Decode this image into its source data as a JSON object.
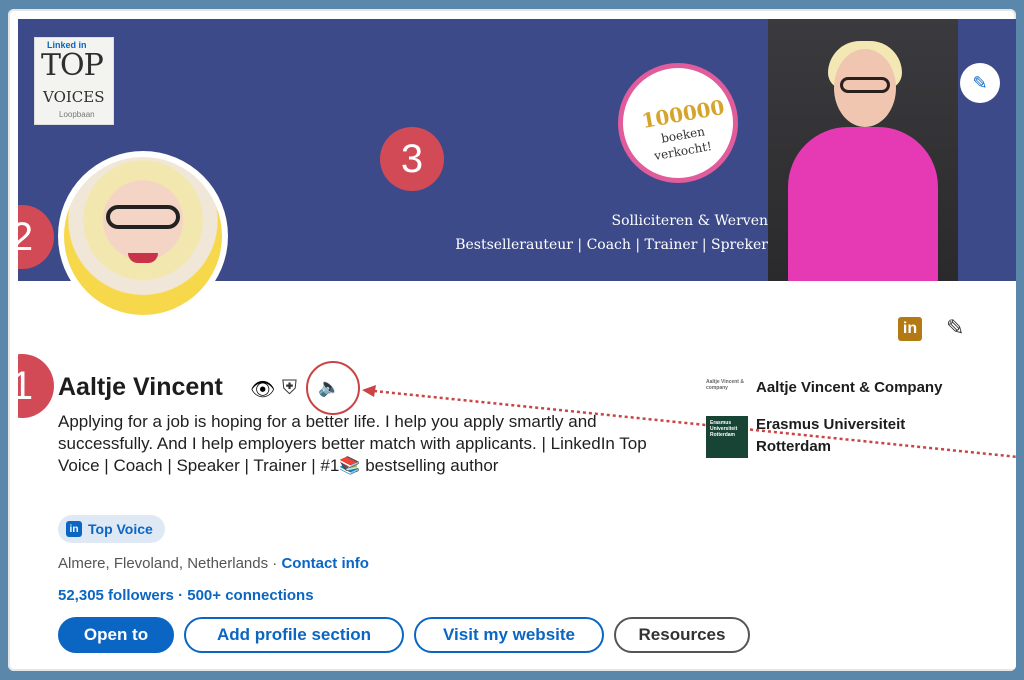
{
  "banner": {
    "badge_linkedin": "Linked in",
    "badge_top": "TOP",
    "badge_voices": "VOICES",
    "badge_sub": "Loopbaan",
    "seal_number": "100000",
    "seal_line1": "boeken",
    "seal_line2": "verkocht!",
    "tagline1": "Solliciteren & Werven",
    "tagline2": "Bestsellerauteur | Coach | Trainer | Spreker"
  },
  "annotations": {
    "n1": "1",
    "n2": "2",
    "n3": "3"
  },
  "profile": {
    "name": "Aaltje Vincent",
    "headline": "Applying for a job is hoping for a better life. I help you apply smartly and successfully. And I help employers better match with applicants. | LinkedIn Top Voice | Coach | Speaker | Trainer | #1📚 bestselling author",
    "badge": "Top Voice",
    "location": "Almere, Flevoland, Netherlands",
    "separator": " · ",
    "contact": "Contact info",
    "followers": "52,305 followers",
    "connections": " · 500+ connections"
  },
  "buttons": {
    "open": "Open to",
    "add": "Add profile section",
    "visit": "Visit my website",
    "resources": "Resources"
  },
  "companies": {
    "c1": "Aaltje Vincent & Company",
    "c1_logo": "Aaltje Vincent & company",
    "c2_line1": "Erasmus Universiteit",
    "c2_line2": "Rotterdam",
    "c2_logo": "Erasmus Universiteit Rotterdam"
  }
}
